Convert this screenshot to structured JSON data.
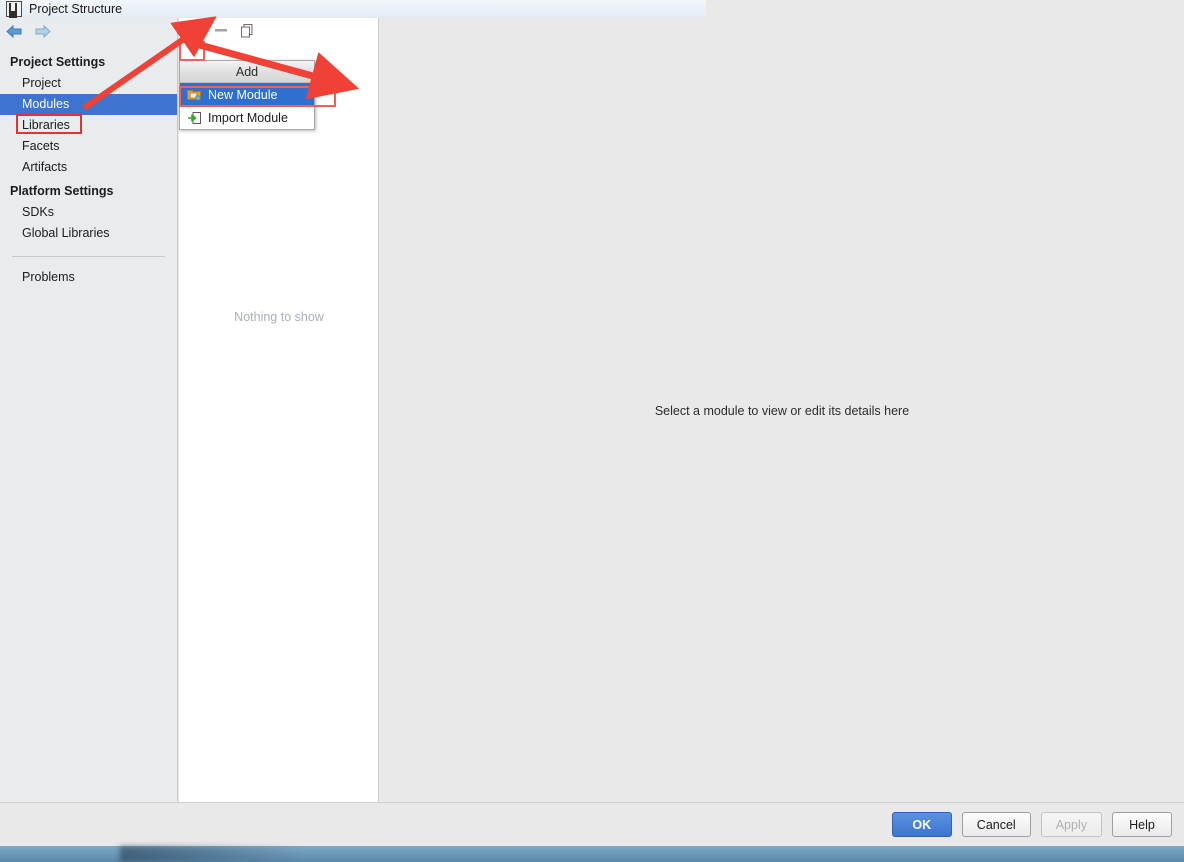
{
  "window": {
    "title": "Project Structure",
    "app_icon": "intellij-idea-icon",
    "close_label": "✕"
  },
  "sidebar": {
    "back_label": "back-arrow",
    "forward_label": "forward-arrow",
    "groups": [
      {
        "title": "Project Settings",
        "items": [
          {
            "label": "Project",
            "selected": false
          },
          {
            "label": "Modules",
            "selected": true
          },
          {
            "label": "Libraries",
            "selected": false
          },
          {
            "label": "Facets",
            "selected": false
          },
          {
            "label": "Artifacts",
            "selected": false
          }
        ]
      },
      {
        "title": "Platform Settings",
        "items": [
          {
            "label": "SDKs",
            "selected": false
          },
          {
            "label": "Global Libraries",
            "selected": false
          }
        ]
      }
    ],
    "footer_items": [
      {
        "label": "Problems",
        "selected": false
      }
    ]
  },
  "module_panel": {
    "toolbar": [
      {
        "name": "add-module-button",
        "icon": "plus-icon",
        "color": "#3aa33a"
      },
      {
        "name": "remove-module-button",
        "icon": "minus-icon",
        "color": "#9a9a9a"
      },
      {
        "name": "copy-module-button",
        "icon": "copy-icon",
        "color": "#5a5a5a"
      }
    ],
    "empty_text": "Nothing to show"
  },
  "add_popup": {
    "header": "Add",
    "items": [
      {
        "label": "New Module",
        "icon": "new-folder-icon",
        "highlighted": true
      },
      {
        "label": "Import Module",
        "icon": "import-arrow-icon",
        "highlighted": false
      }
    ]
  },
  "detail_panel": {
    "placeholder": "Select a module to view or edit its details here"
  },
  "buttons": [
    {
      "label": "OK",
      "style": "primary",
      "name": "ok-button"
    },
    {
      "label": "Cancel",
      "style": "normal",
      "name": "cancel-button"
    },
    {
      "label": "Apply",
      "style": "disabled",
      "name": "apply-button"
    },
    {
      "label": "Help",
      "style": "normal",
      "name": "help-button"
    }
  ],
  "annotations": {
    "accent_color": "#e8312a",
    "highlight_color": "#f0605a",
    "selection_color": "#3d74cf"
  }
}
